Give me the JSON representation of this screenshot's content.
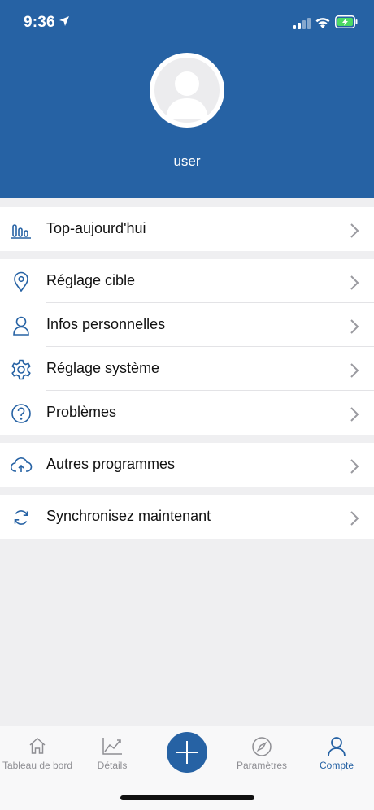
{
  "status_bar": {
    "time": "9:36"
  },
  "profile": {
    "username": "user"
  },
  "menu_groups": [
    {
      "items": [
        {
          "label": "Top-aujourd'hui",
          "icon": "bar-chart-icon"
        }
      ]
    },
    {
      "items": [
        {
          "label": "Réglage cible",
          "icon": "location-pin-icon"
        },
        {
          "label": "Infos personnelles",
          "icon": "person-icon"
        },
        {
          "label": "Réglage système",
          "icon": "gear-icon"
        },
        {
          "label": "Problèmes",
          "icon": "question-icon"
        }
      ]
    },
    {
      "items": [
        {
          "label": "Autres programmes",
          "icon": "cloud-upload-icon"
        }
      ]
    },
    {
      "items": [
        {
          "label": "Synchronisez maintenant",
          "icon": "sync-icon"
        }
      ]
    }
  ],
  "tabbar": {
    "tabs": [
      {
        "label": "Tableau de bord",
        "icon": "home-icon"
      },
      {
        "label": "Détails",
        "icon": "line-chart-icon"
      },
      {
        "label": "Paramètres",
        "icon": "compass-icon"
      },
      {
        "label": "Compte",
        "icon": "account-icon",
        "active": true
      }
    ],
    "add_icon": "plus-icon"
  },
  "colors": {
    "primary": "#2662a4",
    "background": "#efeff1",
    "tab_inactive": "#8e8e93",
    "battery_green": "#4cd964"
  }
}
